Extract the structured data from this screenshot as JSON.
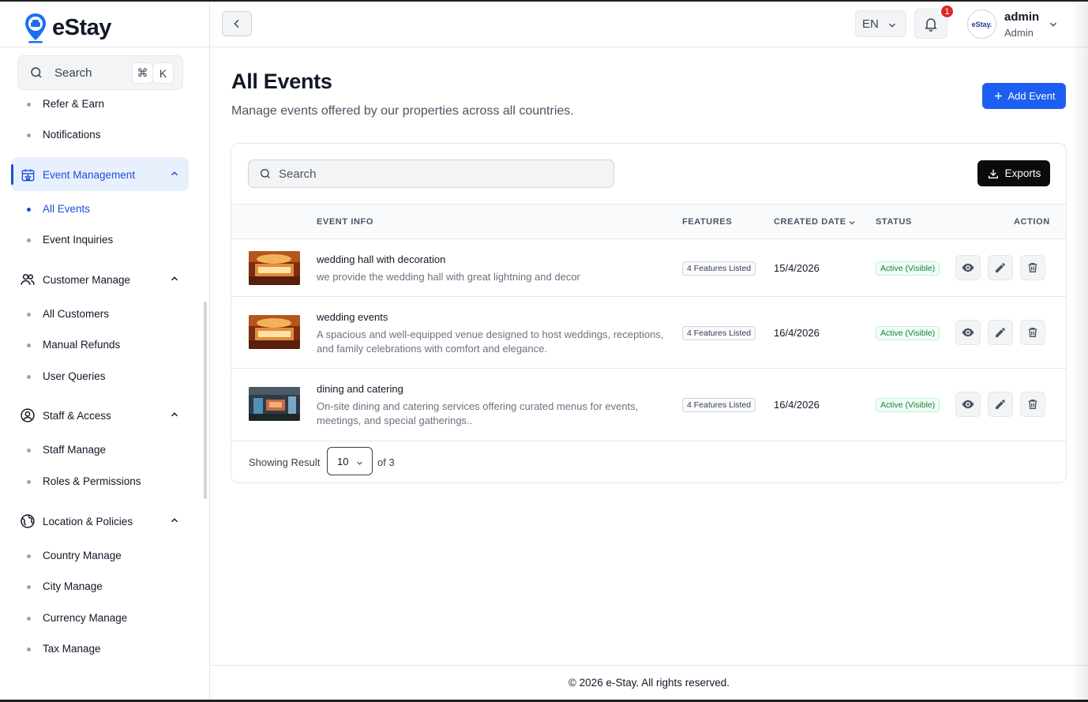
{
  "brand": {
    "name": "eStay"
  },
  "sidebar": {
    "search_placeholder": "Search",
    "shortcut_keys": [
      "⌘",
      "K"
    ],
    "items_top": [
      {
        "label": "Refer & Earn"
      },
      {
        "label": "Notifications"
      }
    ],
    "groups": [
      {
        "label": "Event Management",
        "icon": "calendar-star-icon",
        "items": [
          {
            "label": "All Events",
            "active": true
          },
          {
            "label": "Event Inquiries"
          }
        ]
      },
      {
        "label": "Customer Manage",
        "icon": "users-icon",
        "items": [
          {
            "label": "All Customers"
          },
          {
            "label": "Manual Refunds"
          },
          {
            "label": "User Queries"
          }
        ]
      },
      {
        "label": "Staff & Access",
        "icon": "user-circle-icon",
        "items": [
          {
            "label": "Staff Manage"
          },
          {
            "label": "Roles & Permissions"
          }
        ]
      },
      {
        "label": "Location & Policies",
        "icon": "globe-icon",
        "items": [
          {
            "label": "Country Manage"
          },
          {
            "label": "City Manage"
          },
          {
            "label": "Currency Manage"
          },
          {
            "label": "Tax Manage"
          }
        ]
      }
    ]
  },
  "topbar": {
    "language": "EN",
    "notification_count": "1",
    "user": {
      "avatar_text": "eStay.",
      "name": "admin",
      "role": "Admin"
    }
  },
  "page": {
    "title": "All Events",
    "subtitle": "Manage events offered by our properties across all countries.",
    "add_button": "Add Event"
  },
  "table": {
    "search_placeholder": "Search",
    "export_button": "Exports",
    "columns": {
      "event_info": "EVENT INFO",
      "features": "FEATURES",
      "created_date": "CREATED DATE",
      "status": "STATUS",
      "action": "ACTION"
    },
    "rows": [
      {
        "title": "wedding hall with decoration",
        "description": "we provide the wedding hall with great lightning and decor",
        "features": "4 Features Listed",
        "created": "15/4/2026",
        "status": "Active (Visible)"
      },
      {
        "title": "wedding events",
        "description": "A spacious and well-equipped venue designed to host weddings, receptions, and family celebrations with comfort and elegance.",
        "features": "4 Features Listed",
        "created": "16/4/2026",
        "status": "Active (Visible)"
      },
      {
        "title": "dining and catering",
        "description": "On-site dining and catering services offering curated menus for events, meetings, and special gatherings..",
        "features": "4 Features Listed",
        "created": "16/4/2026",
        "status": "Active (Visible)"
      }
    ],
    "pagination": {
      "showing_label": "Showing Result",
      "page_size": "10",
      "of_label": "of 3"
    }
  },
  "footer": {
    "copyright": "© 2026 e-Stay. All rights reserved."
  },
  "colors": {
    "primary": "#1d5ff0",
    "active_nav": "#1d4ed8",
    "status_green": "#15803d",
    "badge_red": "#dc2626"
  }
}
